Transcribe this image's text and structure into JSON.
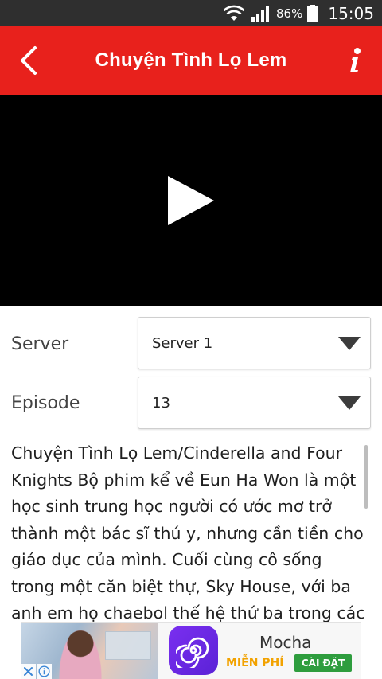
{
  "status_bar": {
    "battery_percent": "86%",
    "time": "15:05",
    "icons": [
      "wifi-icon",
      "signal-icon",
      "battery-icon"
    ]
  },
  "header": {
    "title": "Chuyện Tình Lọ Lem",
    "background_color": "#e8211c",
    "back_icon": "chevron-left-icon",
    "info_icon": "info-icon"
  },
  "player": {
    "play_icon": "play-icon"
  },
  "form": {
    "server_label": "Server",
    "server_value": "Server 1",
    "episode_label": "Episode",
    "episode_value": "13"
  },
  "description": {
    "text": "Chuyện Tình Lọ Lem/Cinderella and Four Knights Bộ phim kể về Eun Ha Won là một học sinh trung học người có ước mơ trở thành một bác sĩ thú y, nhưng cần tiền cho giáo dục của mình. Cuối cùng cô sống trong một căn biệt thự, Sky House, với ba anh em họ chaebol thế hệ thứ ba trong các điều kiện"
  },
  "ad": {
    "app_name": "Mocha",
    "free_label": "MIỄN PHÍ",
    "install_label": "CÀI ĐẶT",
    "icons": [
      "ad-close-icon",
      "ad-choices-icon",
      "mocha-logo-icon"
    ]
  }
}
